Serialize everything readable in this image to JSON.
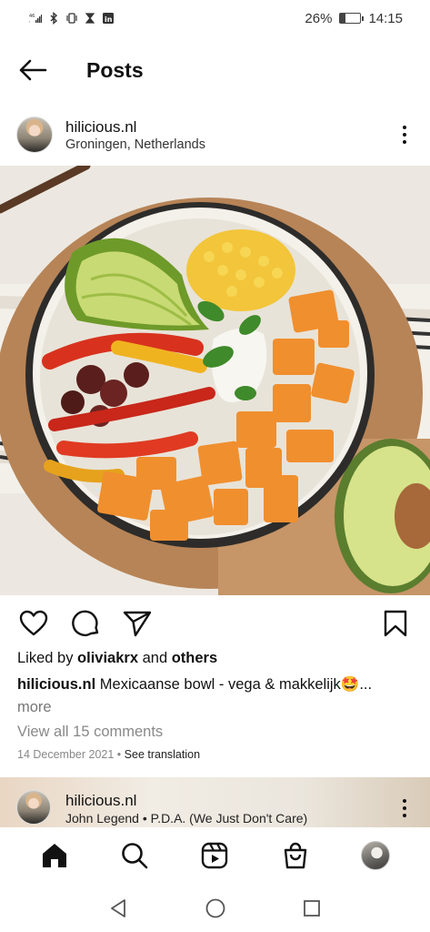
{
  "status_bar": {
    "network": "46 ⁴⁶ᐧ|| ",
    "icons": [
      "signal-icon",
      "bluetooth-icon",
      "vibrate-icon",
      "hourglass-icon",
      "linkedin-icon"
    ],
    "battery_percent": "26%",
    "battery_level": 0.26,
    "time": "14:15"
  },
  "header": {
    "title": "Posts",
    "back_icon": "arrow-left-icon"
  },
  "post": {
    "username": "hilicious.nl",
    "location": "Groningen, Netherlands",
    "image_alt": "Mexican bowl with avocado, corn, sweet potato, peppers and beans",
    "likes_prefix": "Liked by ",
    "likes_user": "oliviakrx",
    "likes_mid": " and ",
    "likes_others": "others",
    "caption_user": "hilicious.nl",
    "caption_text": " Mexicaanse bowl - vega & makkelijk🤩...",
    "caption_more": "more",
    "comments_link": "View all 15 comments",
    "date": "14 December 2021",
    "separator": " • ",
    "see_translation": "See translation"
  },
  "next_post": {
    "username": "hilicious.nl",
    "music": "John Legend • P.D.A. (We Just Don't Care)"
  },
  "bottom_nav": [
    "home-icon",
    "search-icon",
    "reels-icon",
    "shop-icon",
    "profile-avatar"
  ],
  "system_nav": [
    "back-triangle-icon",
    "home-circle-icon",
    "recents-square-icon"
  ]
}
